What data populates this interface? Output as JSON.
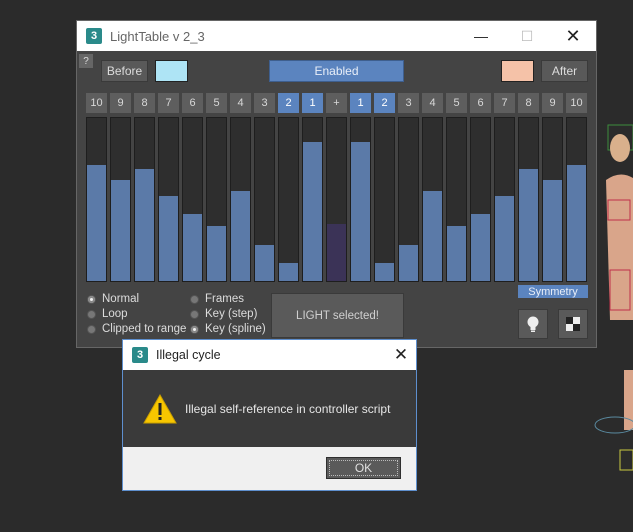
{
  "window": {
    "title": "LightTable v 2_3",
    "help_label": "?",
    "before_label": "Before",
    "after_label": "After",
    "enabled_label": "Enabled",
    "colors": {
      "before": "#aee4f5",
      "after": "#f5c2a8",
      "accent": "#5b84bf"
    },
    "number_buttons": [
      "10",
      "9",
      "8",
      "7",
      "6",
      "5",
      "4",
      "3",
      "2",
      "1",
      "+",
      "1",
      "2",
      "3",
      "4",
      "5",
      "6",
      "7",
      "8",
      "9",
      "10"
    ],
    "bar_levels": [
      0.71,
      0.62,
      0.69,
      0.52,
      0.41,
      0.34,
      0.55,
      0.22,
      0.11,
      0.85,
      0.35,
      0.85,
      0.11,
      0.22,
      0.55,
      0.34,
      0.41,
      0.52,
      0.69,
      0.62,
      0.71
    ],
    "radios_left": [
      {
        "label": "Normal",
        "selected": true
      },
      {
        "label": "Loop",
        "selected": false
      },
      {
        "label": "Clipped to range",
        "selected": false
      }
    ],
    "radios_right": [
      {
        "label": "Frames",
        "selected": false
      },
      {
        "label": "Key (step)",
        "selected": false
      },
      {
        "label": "Key (spline)",
        "selected": true
      }
    ],
    "light_selected_label": "LIGHT selected!",
    "symmetry_label": "Symmetry",
    "icons": {
      "bulb": "lightbulb-icon",
      "checker": "checkerboard-icon"
    }
  },
  "dialog": {
    "title": "Illegal cycle",
    "message": "Illegal self-reference in controller script",
    "ok_label": "OK",
    "icon": "warning-icon"
  }
}
